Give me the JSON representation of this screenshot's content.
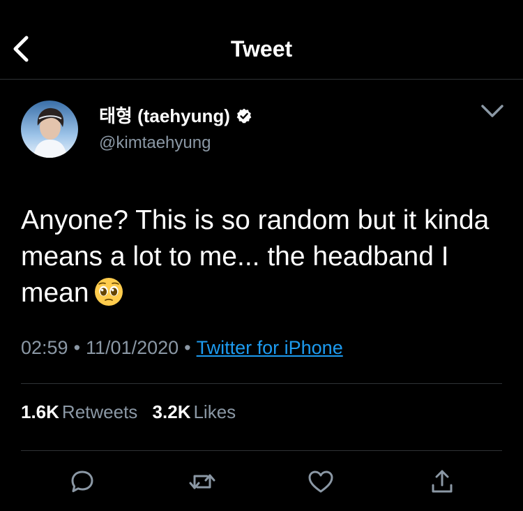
{
  "header": {
    "title": "Tweet",
    "back_icon": "chevron-left-icon"
  },
  "author": {
    "display_name": "태형 (taehyung)",
    "handle": "@kimtaehyung",
    "verified_icon": "verified-badge-icon",
    "more_icon": "chevron-down-icon"
  },
  "tweet": {
    "text": "Anyone? This is so random but it kinda means a lot to me... the headband I mean",
    "emoji": "pleading-face-emoji",
    "time": "02:59",
    "date": "11/01/2020",
    "source": "Twitter for iPhone"
  },
  "stats": {
    "retweets_count": "1.6K",
    "retweets_label": "Retweets",
    "likes_count": "3.2K",
    "likes_label": "Likes"
  },
  "actions": [
    "reply-icon",
    "retweet-icon",
    "like-icon",
    "share-icon"
  ],
  "colors": {
    "background": "#000000",
    "text": "#ffffff",
    "secondary_text": "#8b98a5",
    "link": "#1d9bf0",
    "divider": "#2f3336",
    "icon": "#8b98a5"
  }
}
